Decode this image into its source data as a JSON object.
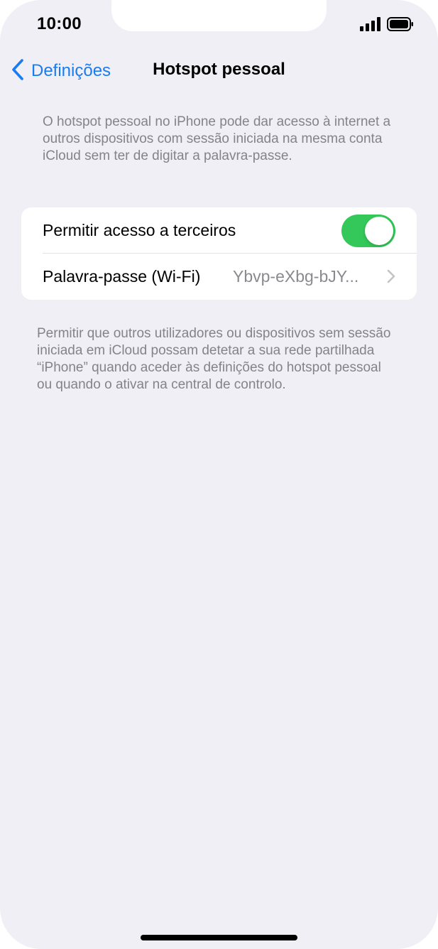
{
  "status_bar": {
    "time": "10:00"
  },
  "nav": {
    "back_label": "Definições",
    "title": "Hotspot pessoal"
  },
  "header_description": "O hotspot pessoal no iPhone pode dar acesso à internet a outros dispositivos com sessão iniciada na mesma conta iCloud sem ter de digitar a palavra-passe.",
  "settings": {
    "allow_others": {
      "label": "Permitir acesso a terceiros",
      "enabled": true
    },
    "wifi_password": {
      "label": "Palavra-passe (Wi-Fi)",
      "value": "Ybvp-eXbg-bJY..."
    }
  },
  "footer_description": "Permitir que outros utilizadores ou dispositivos sem sessão iniciada em iCloud possam detetar a sua rede partilhada “iPhone” quando aceder às definições do hotspot pessoal ou quando o ativar na central de controlo.",
  "colors": {
    "accent": "#1a7cf0",
    "toggle_on": "#34c759",
    "background": "#f0eff5",
    "secondary_text": "#838388"
  },
  "icons": {
    "back": "chevron-left-icon",
    "disclosure": "chevron-right-icon",
    "signal": "cellular-signal-icon",
    "battery": "battery-icon"
  }
}
